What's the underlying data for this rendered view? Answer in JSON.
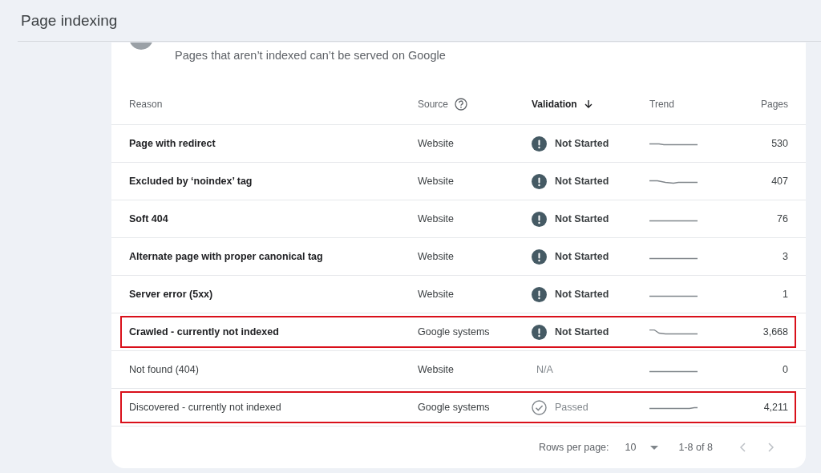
{
  "header": {
    "title": "Page indexing"
  },
  "card": {
    "subtitle": "Pages that aren’t indexed can’t be served on Google"
  },
  "table": {
    "columns": [
      {
        "label": "Reason",
        "kind": "plain"
      },
      {
        "label": "Source",
        "kind": "help"
      },
      {
        "label": "Validation",
        "kind": "sorted"
      },
      {
        "label": "Trend",
        "kind": "plain"
      },
      {
        "label": "Pages",
        "kind": "number"
      }
    ],
    "rows": [
      {
        "reason": "Page with redirect",
        "source": "Website",
        "validation": {
          "kind": "not_started",
          "label": "Not Started"
        },
        "pages": "530",
        "emphasized": true,
        "highlighted": false
      },
      {
        "reason": "Excluded by ‘noindex’ tag",
        "source": "Website",
        "validation": {
          "kind": "not_started",
          "label": "Not Started"
        },
        "pages": "407",
        "emphasized": true,
        "highlighted": false
      },
      {
        "reason": "Soft 404",
        "source": "Website",
        "validation": {
          "kind": "not_started",
          "label": "Not Started"
        },
        "pages": "76",
        "emphasized": true,
        "highlighted": false
      },
      {
        "reason": "Alternate page with proper canonical tag",
        "source": "Website",
        "validation": {
          "kind": "not_started",
          "label": "Not Started"
        },
        "pages": "3",
        "emphasized": true,
        "highlighted": false
      },
      {
        "reason": "Server error (5xx)",
        "source": "Website",
        "validation": {
          "kind": "not_started",
          "label": "Not Started"
        },
        "pages": "1",
        "emphasized": true,
        "highlighted": false
      },
      {
        "reason": "Crawled - currently not indexed",
        "source": "Google systems",
        "validation": {
          "kind": "not_started",
          "label": "Not Started"
        },
        "pages": "3,668",
        "emphasized": true,
        "highlighted": true
      },
      {
        "reason": "Not found (404)",
        "source": "Website",
        "validation": {
          "kind": "none",
          "label": "N/A"
        },
        "pages": "0",
        "emphasized": false,
        "highlighted": false
      },
      {
        "reason": "Discovered - currently not indexed",
        "source": "Google systems",
        "validation": {
          "kind": "passed",
          "label": "Passed"
        },
        "pages": "4,211",
        "emphasized": false,
        "highlighted": true
      }
    ]
  },
  "pagination": {
    "rows_per_page_label": "Rows per page:",
    "rows_per_page": "10",
    "range": "1-8 of 8"
  }
}
